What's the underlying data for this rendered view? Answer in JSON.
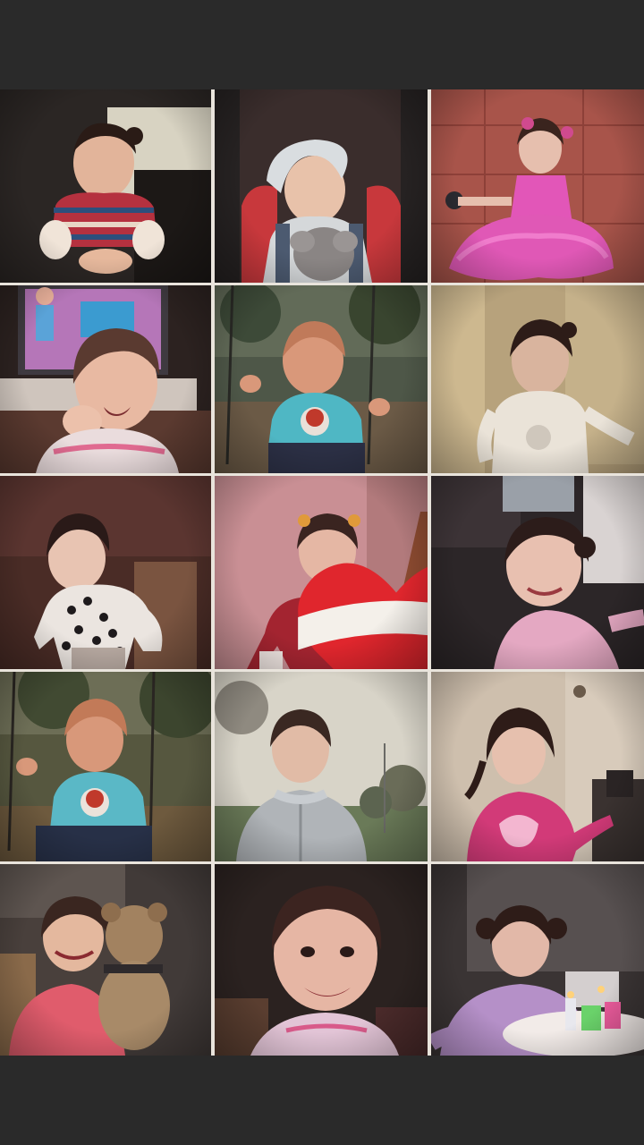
{
  "collage": {
    "rows": 5,
    "columns": 3,
    "photo_count": 15
  },
  "colors": {
    "page_background": "#2a2a2a",
    "grid_gap": "#e9e4dc",
    "heart_sticker_red": "#e0262d",
    "heart_sticker_band": "#f4f0ea"
  },
  "icons": [
    "heart-sticker-icon"
  ]
}
